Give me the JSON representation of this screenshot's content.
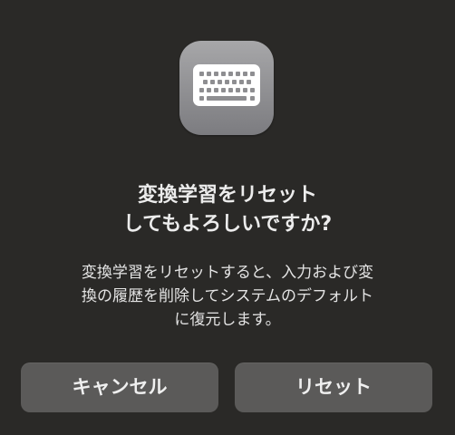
{
  "dialog": {
    "icon": "keyboard-icon",
    "title": "変換学習をリセット\nしてもよろしいですか?",
    "message": "変換学習をリセットすると、入力および変\n換の履歴を削除してシステムのデフォルト\nに復元します。",
    "buttons": {
      "cancel_label": "キャンセル",
      "reset_label": "リセット"
    }
  },
  "colors": {
    "background": "#2a2927",
    "button": "#5b5a59",
    "icon_tile": "#9a9a9d"
  }
}
